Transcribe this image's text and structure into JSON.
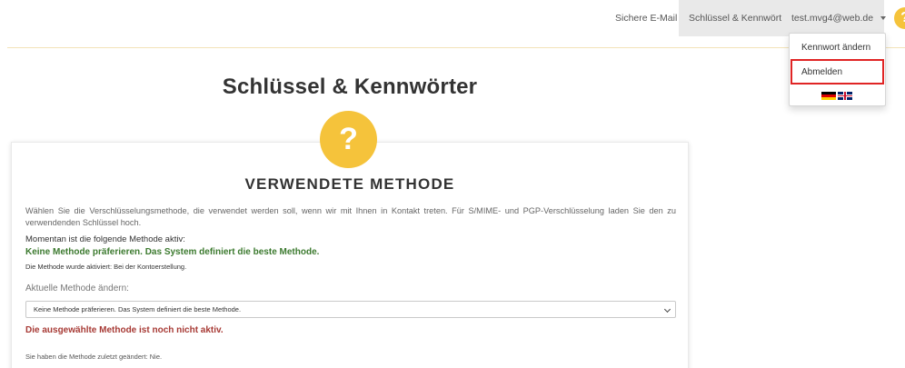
{
  "nav": {
    "secure_email": "Sichere E-Mail",
    "keys_passwords": "Schlüssel & Kennwörter",
    "user_email": "test.mvg4@web.de",
    "help_glyph": "?"
  },
  "dropdown": {
    "change_password": "Kennwort ändern",
    "logout": "Abmelden",
    "languages": [
      "de-flag",
      "uk-flag"
    ]
  },
  "page": {
    "title": "Schlüssel & Kennwörter",
    "help_glyph": "?",
    "heading": "VERWENDETE METHODE",
    "description": "Wählen Sie die Verschlüsselungsmethode, die verwendet werden soll, wenn wir mit Ihnen in Kontakt treten. Für S/MIME- und PGP-Verschlüsselung laden Sie den zu verwendenden Schlüssel hoch.",
    "current_label": "Momentan ist die folgende Methode aktiv:",
    "current_method": "Keine Methode präferieren. Das System definiert die beste Methode.",
    "activated_text": "Die Methode wurde aktiviert: Bei der Kontoerstellung.",
    "change_label": "Aktuelle Methode ändern:",
    "select_value": "Keine Methode präferieren. Das System definiert die beste Methode.",
    "not_active": "Die ausgewählte Methode ist noch nicht aktiv.",
    "last_changed": "Sie haben die Methode zuletzt geändert: Nie."
  },
  "colors": {
    "accent_yellow": "#f5c33b",
    "success_green": "#3c7a2f",
    "error_red": "#a73a35",
    "highlight_red": "#e02424"
  }
}
